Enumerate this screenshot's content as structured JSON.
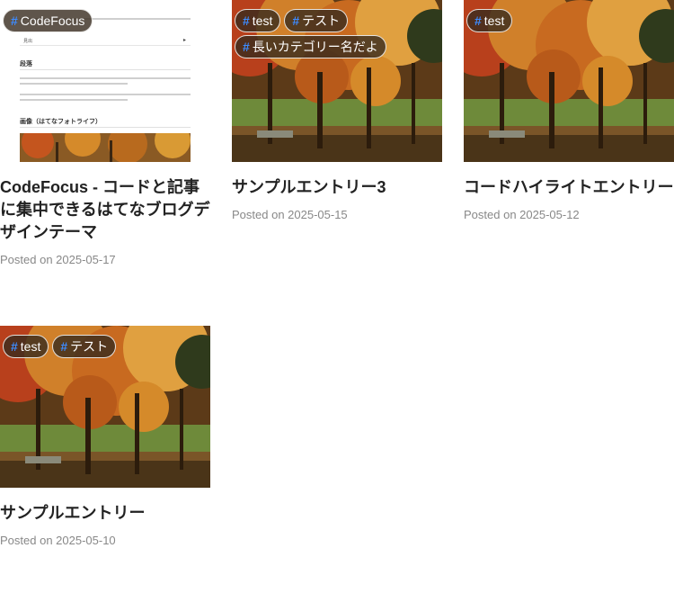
{
  "articles": [
    {
      "tags": [
        "CodeFocus"
      ],
      "title": "CodeFocus - コードと記事に集中できるはてなブログデザインテーマ",
      "date": "Posted on 2025-05-17",
      "thumbnail": "theme-preview",
      "preview": {
        "box_label": "見出",
        "heading1": "段落",
        "heading2": "画像（はてなフォトライフ）",
        "arrow": "▸"
      }
    },
    {
      "tags": [
        "test",
        "テスト",
        "長いカテゴリー名だよ"
      ],
      "title": "サンプルエントリー3",
      "date": "Posted on 2025-05-15",
      "thumbnail": "autumn-park"
    },
    {
      "tags": [
        "test"
      ],
      "title": "コードハイライトエントリー",
      "date": "Posted on 2025-05-12",
      "thumbnail": "autumn-park"
    },
    {
      "tags": [
        "test",
        "テスト"
      ],
      "title": "サンプルエントリー",
      "date": "Posted on 2025-05-10",
      "thumbnail": "autumn-park"
    }
  ],
  "tag_prefix": "#",
  "colors": {
    "hash": "#3d8bff",
    "tag_bg": "#372a1e",
    "title": "#222222",
    "date": "#888888"
  }
}
